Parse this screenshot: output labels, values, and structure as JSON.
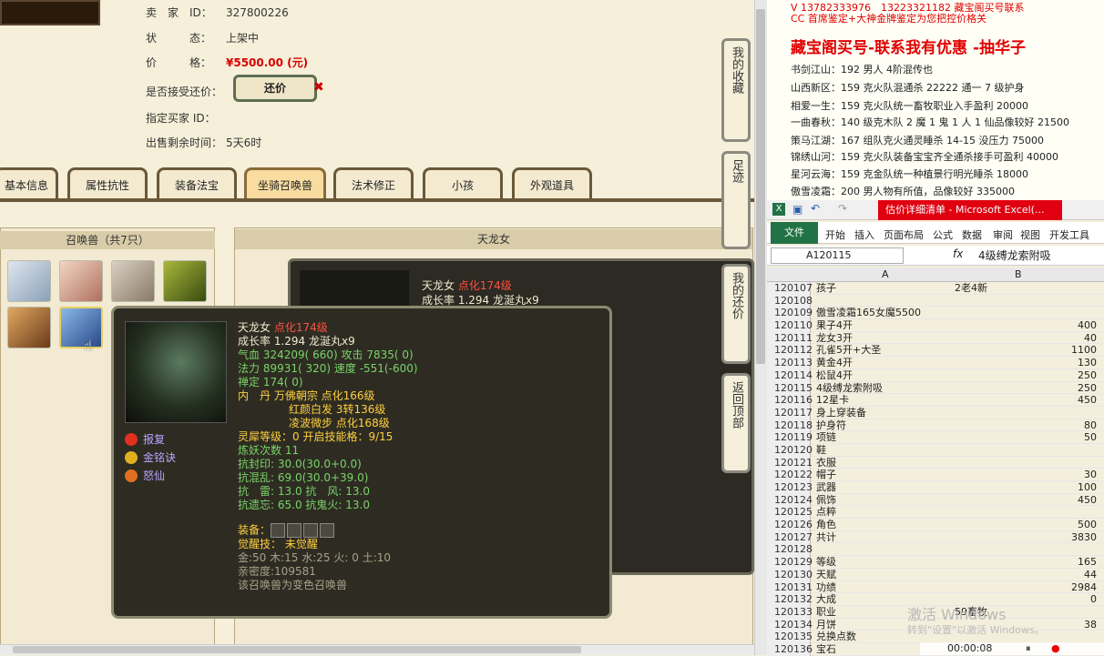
{
  "seller": {
    "id_label": "卖　家　ID：",
    "id_value": "327800226",
    "status_label": "状　　　态：",
    "status_value": "上架中",
    "price_label": "价　　　格：",
    "price_value": "¥5500.00 (元)",
    "accept_bargain_label": "是否接受还价：",
    "bargain_button": "还价",
    "buyer_id_label": "指定买家 ID：",
    "time_left_label": "出售剩余时间：",
    "time_left_value": "5天6时"
  },
  "tabs": [
    "基本信息",
    "属性抗性",
    "装备法宝",
    "坐骑召唤兽",
    "法术修正",
    "小孩",
    "外观道具"
  ],
  "active_tab": "坐骑召唤兽",
  "summon": {
    "title": "召唤兽（共7只）",
    "detail_title": "天龙女",
    "card_name": "天龙女",
    "card_level": "点化174级",
    "card_growth": "成长率 1.294 龙涎丸x9"
  },
  "side_tabs": [
    "我的收藏",
    "足迹",
    "我的还价",
    "返回顶部"
  ],
  "tooltip": {
    "name": "天龙女",
    "level": "点化174级",
    "growth": "成长率 1.294 龙涎丸x9",
    "hp": "气血 324209( 660) 攻击 7835( 0)",
    "mp": "法力 89931( 320) 速度 -551(-600)",
    "zen": "禅定 174( 0)",
    "neidan1": "内　丹 万佛朝宗 点化166级",
    "neidan2": "红颜白发 3转136级",
    "neidan3": "凌波微步 点化168级",
    "lingxi": "灵犀等级：0 开启技能格：9/15",
    "lianyao": "炼妖次数 11",
    "kangfeng": "抗封印: 30.0(30.0+0.0)",
    "kanghun": "抗混乱: 69.0(30.0+39.0)",
    "kangleifeng": "抗　雷: 13.0 抗　风: 13.0",
    "kangyiwang": "抗遗忘: 65.0 抗鬼火: 13.0",
    "equip_label": "装备：",
    "awaken": "觉醒技： 未觉醒",
    "elements": "金:50 木:15 水:25 火: 0 土:10",
    "intimacy": "亲密度:109581",
    "note": "该召唤兽为变色召唤兽",
    "skills": [
      "报复",
      "金铭诀",
      "怒仙"
    ]
  },
  "ad": {
    "top": "V 13782333976　13223321182 藏宝阁买号联系",
    "cc": "CC 首席鉴定+大神金牌鉴定为您把控价格关",
    "headline": "藏宝阁买号-联系我有优惠 -抽华子",
    "lines": [
      "书剑江山：192 男人 4阶混传也",
      "山西新区：159 克火队混通杀 22222 通一 7 级护身",
      "相爱一生：159 克火队统一畜牧职业入手盈利 20000",
      "一曲春秋：140 级克木队 2 魔 1 鬼 1 人 1 仙品像较好 21500",
      "策马江湖：167 组队克火通灵睡杀 14-15 没压力 75000",
      "锦绣山河：159 克火队装备宝宝齐全通杀接手可盈利 40000",
      "星河云海：159 克金队统一种植景行明光睡杀 18000",
      "傲雪凌霜：200 男人物有所值，品像较好 335000"
    ]
  },
  "excel": {
    "title": "估价详细清单 - Microsoft Excel(...",
    "ribbon": [
      "开始",
      "插入",
      "页面布局",
      "公式",
      "数据",
      "审阅",
      "视图",
      "开发工具"
    ],
    "file_tab": "文件",
    "namebox": "A120115",
    "formula": "4级缚龙索附吸",
    "col_a": "A",
    "col_b": "B",
    "rows": [
      {
        "n": "120107",
        "a": "孩子",
        "b": "2老4新",
        "num": false
      },
      {
        "n": "120108",
        "a": "",
        "b": "",
        "num": false
      },
      {
        "n": "120109",
        "a": "傲雪凌霜165女魔5500",
        "b": "",
        "num": false
      },
      {
        "n": "120110",
        "a": "果子4开",
        "b": "400",
        "num": true
      },
      {
        "n": "120111",
        "a": "龙女3开",
        "b": "40",
        "num": true
      },
      {
        "n": "120112",
        "a": "孔雀5开+大圣",
        "b": "1100",
        "num": true
      },
      {
        "n": "120113",
        "a": "黄金4开",
        "b": "130",
        "num": true
      },
      {
        "n": "120114",
        "a": "松鼠4开",
        "b": "250",
        "num": true
      },
      {
        "n": "120115",
        "a": "4级缚龙索附吸",
        "b": "250",
        "num": true
      },
      {
        "n": "120116",
        "a": "12星卡",
        "b": "450",
        "num": true
      },
      {
        "n": "120117",
        "a": "身上穿装备",
        "b": "",
        "num": false
      },
      {
        "n": "120118",
        "a": "护身符",
        "b": "80",
        "num": true
      },
      {
        "n": "120119",
        "a": "项链",
        "b": "50",
        "num": true
      },
      {
        "n": "120120",
        "a": "鞋",
        "b": "",
        "num": false
      },
      {
        "n": "120121",
        "a": "衣服",
        "b": "",
        "num": false
      },
      {
        "n": "120122",
        "a": "帽子",
        "b": "30",
        "num": true
      },
      {
        "n": "120123",
        "a": "武器",
        "b": "100",
        "num": true
      },
      {
        "n": "120124",
        "a": "佩饰",
        "b": "450",
        "num": true
      },
      {
        "n": "120125",
        "a": "点粹",
        "b": "",
        "num": false
      },
      {
        "n": "120126",
        "a": "角色",
        "b": "500",
        "num": true
      },
      {
        "n": "120127",
        "a": "共计",
        "b": "3830",
        "num": true
      },
      {
        "n": "120128",
        "a": "",
        "b": "",
        "num": false
      },
      {
        "n": "120129",
        "a": "等级",
        "b": "165",
        "num": true
      },
      {
        "n": "120130",
        "a": "天赋",
        "b": "44",
        "num": true
      },
      {
        "n": "120131",
        "a": "功绩",
        "b": "2984",
        "num": true
      },
      {
        "n": "120132",
        "a": "大成",
        "b": "0",
        "num": true
      },
      {
        "n": "120133",
        "a": "职业",
        "b": "59畜牧",
        "num": false
      },
      {
        "n": "120134",
        "a": "月饼",
        "b": "38",
        "num": true
      },
      {
        "n": "120135",
        "a": "兑换点数",
        "b": "",
        "num": false
      },
      {
        "n": "120136",
        "a": "宝石",
        "b": "",
        "num": false
      }
    ]
  },
  "watermark": {
    "line1": "激活 Windows",
    "line2": "转到\"设置\"以激活 Windows。"
  },
  "player": {
    "time": "00:00:08"
  },
  "colors": {
    "price_red": "#d80000",
    "excel_green": "#217346",
    "ad_red": "#e00000"
  }
}
